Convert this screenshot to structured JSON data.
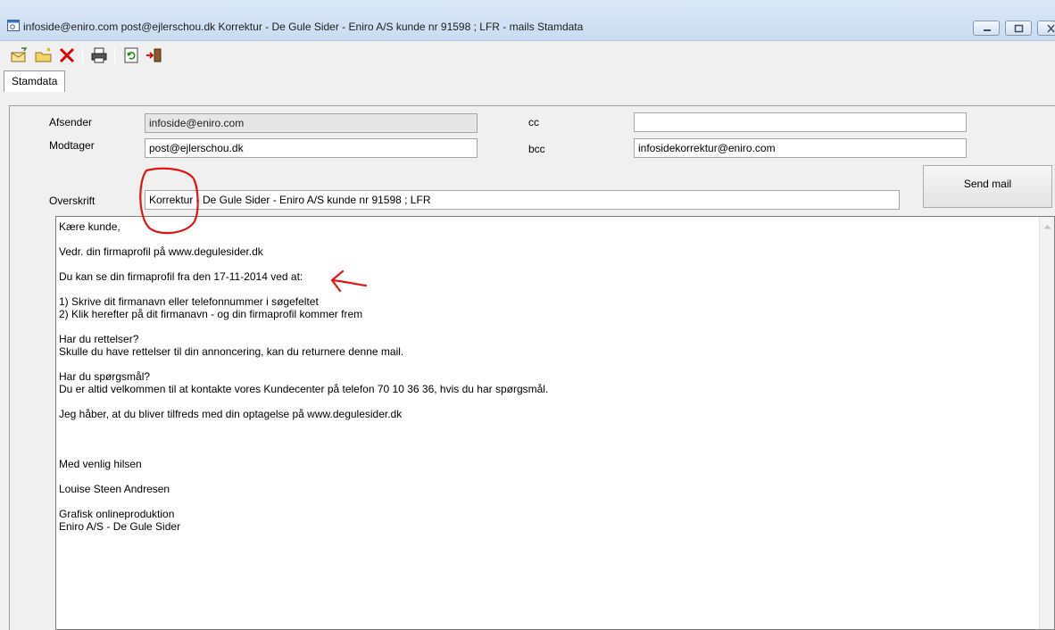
{
  "window": {
    "title": "infoside@eniro.com post@ejlerschou.dk Korrektur - De Gule Sider - Eniro A/S kunde nr 91598 ; LFR - mails Stamdata"
  },
  "tabs": [
    {
      "label": "Stamdata"
    }
  ],
  "form": {
    "afsender_label": "Afsender",
    "afsender_value": "infoside@eniro.com",
    "modtager_label": "Modtager",
    "modtager_value": "post@ejlerschou.dk",
    "cc_label": "cc",
    "cc_value": "",
    "bcc_label": "bcc",
    "bcc_value": "infosidekorrektur@eniro.com",
    "overskrift_label": "Overskrift",
    "overskrift_value": "Korrektur - De Gule Sider - Eniro A/S kunde nr 91598 ; LFR",
    "send_label": "Send mail"
  },
  "body_lines": [
    "Kære kunde,",
    "",
    "Vedr. din firmaprofil på www.degulesider.dk",
    "",
    "Du kan se din firmaprofil fra den 17-11-2014 ved at:",
    "",
    "1) Skrive dit firmanavn eller telefonnummer i søgefeltet",
    "2) Klik herefter på dit firmanavn - og din firmaprofil kommer frem",
    "",
    "Har du rettelser?",
    "Skulle du have rettelser til din annoncering, kan du returnere denne mail.",
    "",
    "Har du spørgsmål?",
    "Du er altid velkommen til at kontakte vores Kundecenter på telefon 70 10 36 36, hvis du har spørgsmål.",
    "",
    "Jeg håber, at du bliver tilfreds med din optagelse på www.degulesider.dk",
    "",
    "",
    "",
    "Med venlig hilsen",
    "",
    "Louise Steen Andresen",
    "",
    "Grafisk onlineproduktion",
    "Eniro A/S - De Gule Sider"
  ],
  "icons": {
    "app": "app-window-icon",
    "minimize": "minimize-icon",
    "maximize": "maximize-icon",
    "close": "close-icon",
    "toolbar": [
      "new-mail-icon",
      "open-folder-icon",
      "delete-x-icon",
      "print-icon",
      "refresh-icon",
      "exit-icon"
    ]
  },
  "colors": {
    "annotation_red": "#e01515",
    "delete_red": "#d80000"
  }
}
